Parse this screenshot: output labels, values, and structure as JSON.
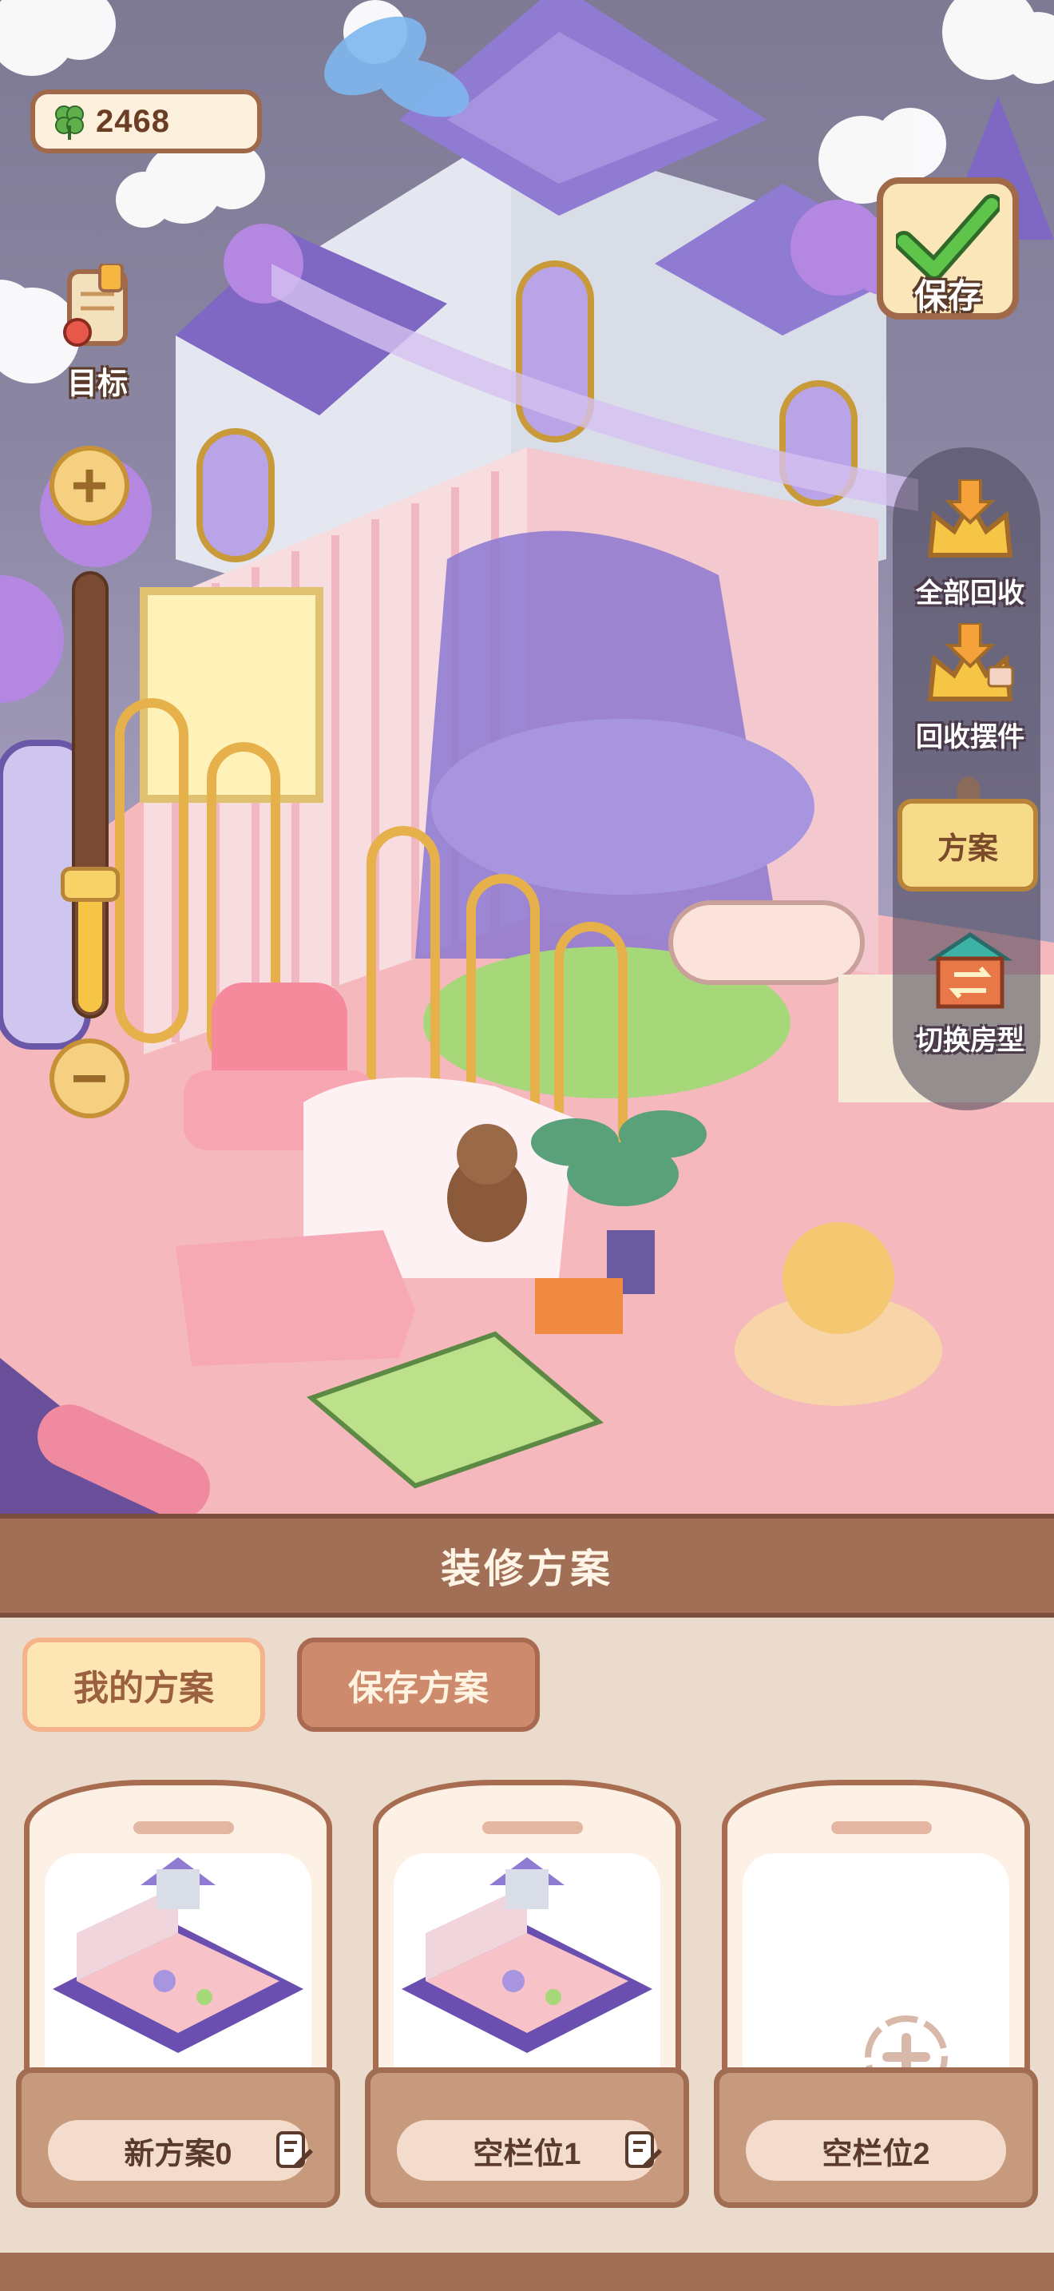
{
  "hud": {
    "currency_value": "2468",
    "currency_icon": "clover-icon",
    "goal_label": "目标",
    "save_label": "保存"
  },
  "side_menu": {
    "recall_all_label": "全部回收",
    "recall_items_label": "回收摆件",
    "scheme_label": "方案",
    "switch_room_label": "切换房型"
  },
  "panel": {
    "title": "装修方案",
    "tabs": [
      {
        "label": "我的方案",
        "active": true
      },
      {
        "label": "保存方案",
        "active": false
      }
    ],
    "slots": [
      {
        "name": "新方案0",
        "filled": true
      },
      {
        "name": "空栏位1",
        "filled": true
      },
      {
        "name": "空栏位2",
        "filled": false
      }
    ]
  },
  "colors": {
    "panel_header": "#a06f55",
    "tab_active": "#fde6b4",
    "tab_inactive": "#cd8a6c",
    "accent_gold": "#f7c545"
  }
}
